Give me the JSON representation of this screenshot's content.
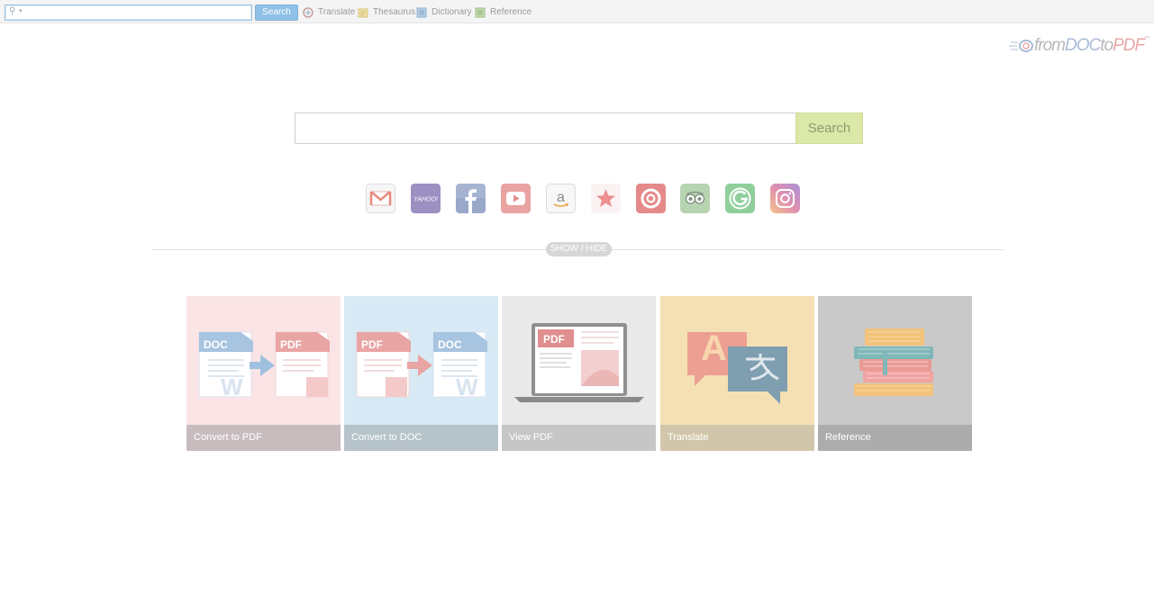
{
  "toolbar": {
    "search_placeholder": "",
    "search_button": "Search",
    "links": [
      {
        "label": "Translate",
        "icon": "translate-icon"
      },
      {
        "label": "Thesaurus",
        "icon": "thesaurus-icon"
      },
      {
        "label": "Dictionary",
        "icon": "dictionary-icon"
      },
      {
        "label": "Reference",
        "icon": "reference-icon"
      }
    ]
  },
  "logo": {
    "part1": "from",
    "part2": "DOC",
    "part3": "to",
    "part4": "PDF",
    "tm": "™"
  },
  "main_search": {
    "placeholder": "",
    "button": "Search"
  },
  "quick_links": [
    {
      "name": "gmail-icon",
      "color": "#e98a80"
    },
    {
      "name": "yahoo-icon",
      "color": "#9c8fc2"
    },
    {
      "name": "facebook-icon",
      "color": "#8ea0c6"
    },
    {
      "name": "youtube-icon",
      "color": "#e38a88"
    },
    {
      "name": "amazon-icon",
      "color": "#f2a64a"
    },
    {
      "name": "macys-star-icon",
      "color": "#ec8f8f"
    },
    {
      "name": "target-icon",
      "color": "#e58a8a"
    },
    {
      "name": "tripadvisor-icon",
      "color": "#a6c9a0"
    },
    {
      "name": "grammarly-icon",
      "color": "#8fcf9c"
    },
    {
      "name": "instagram-icon",
      "color": "#c98fc4"
    }
  ],
  "divider": {
    "toggle_label": "SHOW / HIDE"
  },
  "tiles": [
    {
      "label": "Convert to PDF",
      "from": "DOC",
      "to": "PDF"
    },
    {
      "label": "Convert to DOC",
      "from": "PDF",
      "to": "DOC"
    },
    {
      "label": "View PDF",
      "badge": "PDF"
    },
    {
      "label": "Translate",
      "letter": "A"
    },
    {
      "label": "Reference"
    }
  ],
  "colors": {
    "toolbar_button": "#8fc1e6",
    "main_search_button": "#dbe8a8",
    "doc_blue": "#9fc0df",
    "pdf_red": "#e9a4a4"
  }
}
